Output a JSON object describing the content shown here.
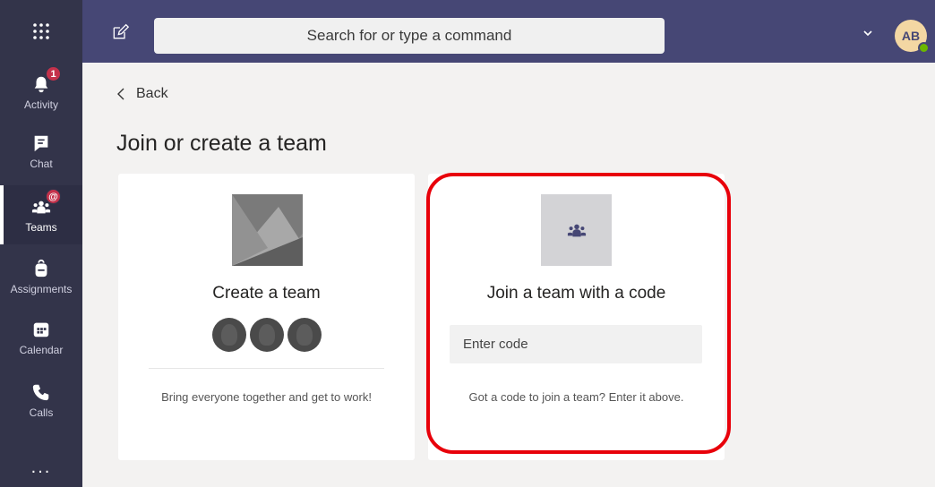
{
  "topbar": {
    "search_placeholder": "Search for or type a command",
    "avatar_initials": "AB",
    "icons": {
      "apps": "waffle-grid-icon",
      "compose": "compose-icon",
      "dropdown": "chevron-down-icon"
    }
  },
  "rail": {
    "items": [
      {
        "label": "Activity",
        "icon": "bell-icon",
        "badge": "1"
      },
      {
        "label": "Chat",
        "icon": "chat-icon"
      },
      {
        "label": "Teams",
        "icon": "teams-icon",
        "badge": "@",
        "active": true
      },
      {
        "label": "Assignments",
        "icon": "backpack-icon"
      },
      {
        "label": "Calendar",
        "icon": "calendar-icon"
      },
      {
        "label": "Calls",
        "icon": "phone-icon"
      }
    ],
    "more_label": "..."
  },
  "main": {
    "back_label": "Back",
    "page_title": "Join or create a team",
    "create_card": {
      "title": "Create a team",
      "description": "Bring everyone together and get to work!"
    },
    "join_card": {
      "title": "Join a team with a code",
      "code_placeholder": "Enter code",
      "description": "Got a code to join a team? Enter it above."
    }
  },
  "colors": {
    "topbar": "#464775",
    "rail": "#33344a",
    "badge": "#c4314b",
    "highlight": "#e8000a",
    "presence": "#6bb700"
  }
}
